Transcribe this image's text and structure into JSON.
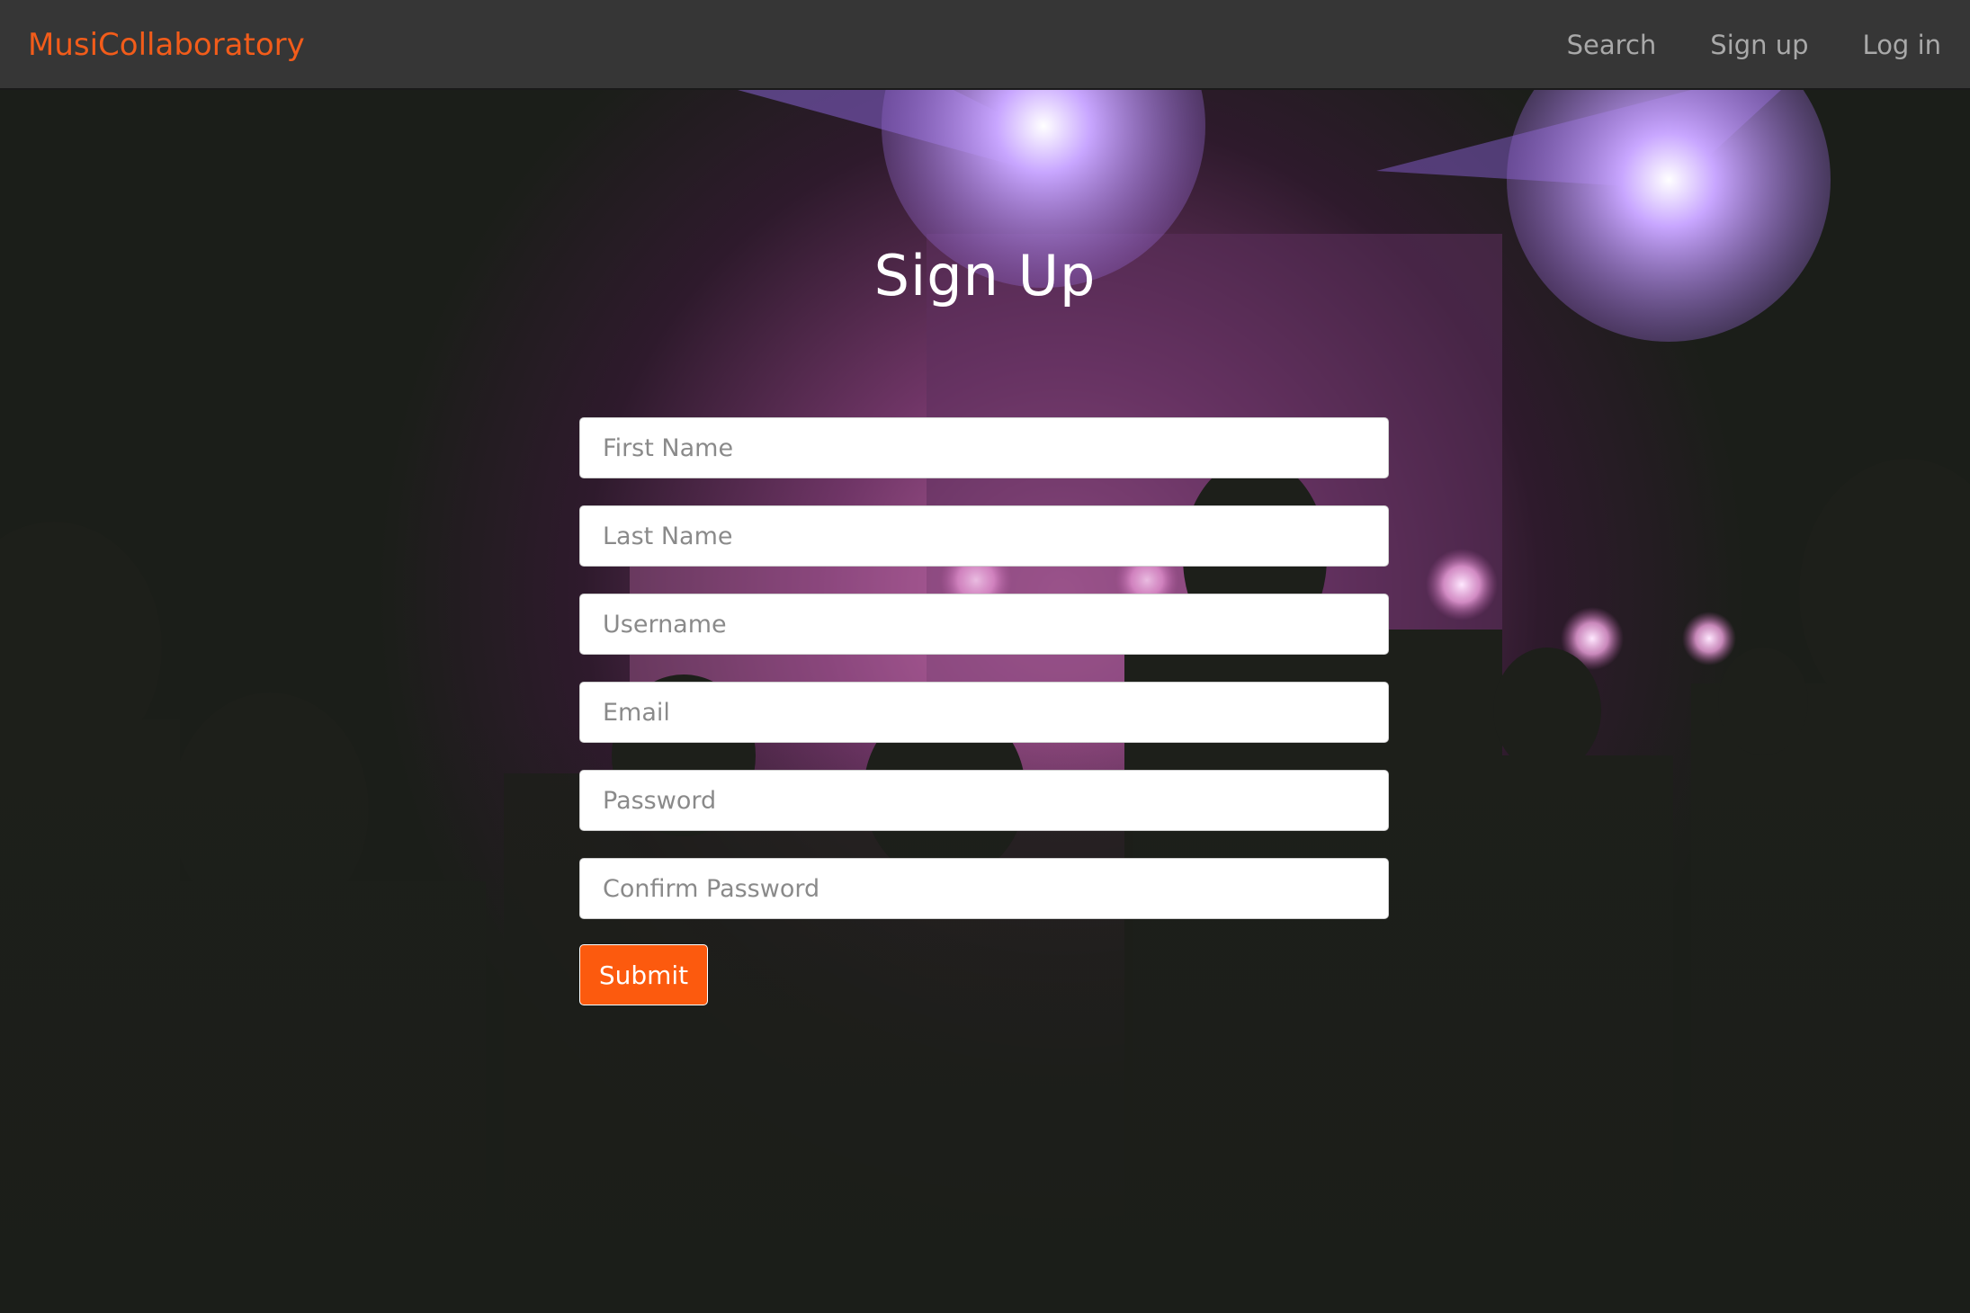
{
  "app": {
    "brand": "MusiCollaboratory",
    "accent_color": "#fc5a0e"
  },
  "nav": {
    "items": [
      {
        "label": "Search"
      },
      {
        "label": "Sign up"
      },
      {
        "label": "Log in"
      }
    ]
  },
  "page": {
    "title": "Sign Up"
  },
  "form": {
    "fields": [
      {
        "placeholder": "First Name",
        "value": ""
      },
      {
        "placeholder": "Last Name",
        "value": ""
      },
      {
        "placeholder": "Username",
        "value": ""
      },
      {
        "placeholder": "Email",
        "value": ""
      },
      {
        "placeholder": "Password",
        "value": ""
      },
      {
        "placeholder": "Confirm Password",
        "value": ""
      }
    ],
    "submit_label": "Submit"
  }
}
